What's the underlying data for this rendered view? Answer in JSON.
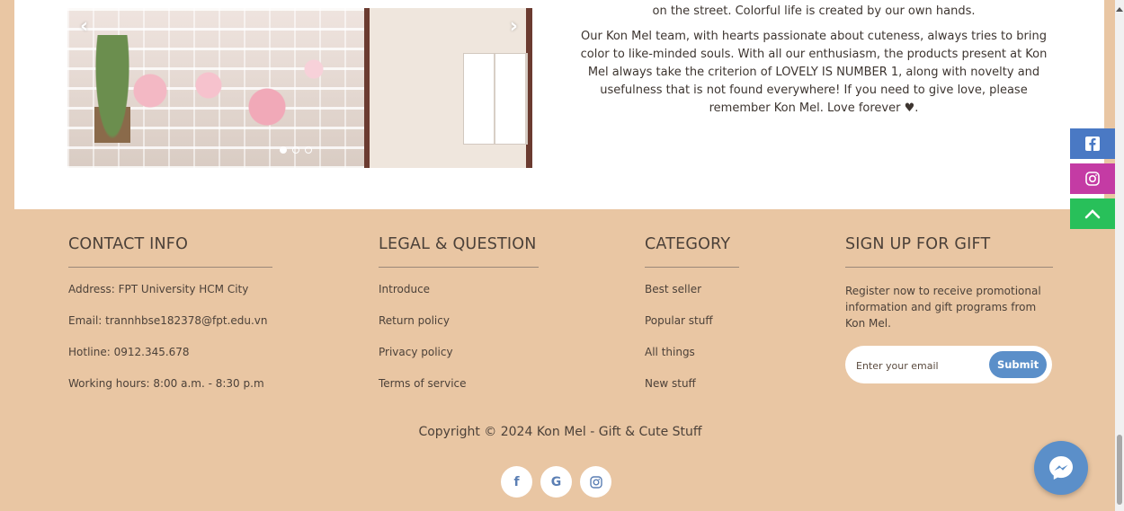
{
  "about": {
    "line_top": "on the street. Colorful life is created by our own hands.",
    "paragraph": "Our Kon Mel team, with hearts passionate about cuteness, always tries to bring color to like-minded souls. With all our enthusiasm, the products present at Kon Mel always take the criterion of LOVELY IS NUMBER 1, along with novelty and usefulness that is not found everywhere! If you need to give love, please remember Kon Mel. Love forever ♥."
  },
  "carousel": {
    "prev_icon": "chevron-left-icon",
    "next_icon": "chevron-right-icon",
    "slide_count": 3,
    "active_slide": 1
  },
  "footer": {
    "contact": {
      "title": "CONTACT INFO",
      "address": "Address: FPT University HCM City",
      "email": "Email: trannhbse182378@fpt.edu.vn",
      "hotline": "Hotline: 0912.345.678",
      "hours": "Working hours: 8:00 a.m. - 8:30 p.m"
    },
    "legal": {
      "title": "LEGAL & QUESTION",
      "items": [
        "Introduce",
        "Return policy",
        "Privacy policy",
        "Terms of service"
      ]
    },
    "category": {
      "title": "CATEGORY",
      "items": [
        "Best seller",
        "Popular stuff",
        "All things",
        "New stuff"
      ]
    },
    "gift": {
      "title": "SIGN UP FOR GIFT",
      "text": "Register now to receive promotional information and gift programs from Kon Mel.",
      "email_placeholder": "Enter your email",
      "submit_label": "Submit"
    },
    "copyright": "Copyright © 2024 Kon Mel - Gift & Cute Stuff",
    "social": {
      "facebook": "f",
      "google": "G"
    }
  },
  "colors": {
    "footer_bg": "#e9c6a3",
    "submit_bg": "#5b8fc9",
    "facebook_side": "#4a79c4",
    "instagram_side": "#c43ba4",
    "top_side": "#28c05a",
    "messenger": "#5b8fc9"
  },
  "icons": {
    "side": [
      "facebook-icon",
      "instagram-icon",
      "chevron-up-icon"
    ],
    "messenger": "messenger-icon",
    "social_row": [
      "facebook-icon",
      "google-icon",
      "instagram-icon"
    ]
  }
}
